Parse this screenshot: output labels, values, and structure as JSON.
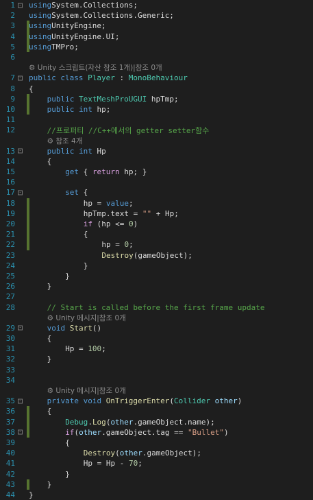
{
  "editor": {
    "language": "C#",
    "lines": [
      {
        "n": "1",
        "indent": 0,
        "changed": false,
        "fold": "-",
        "tokens": [
          [
            "kw",
            "using"
          ],
          [
            "",
            "System.Collections;"
          ]
        ]
      },
      {
        "n": "2",
        "indent": 0,
        "changed": false,
        "fold": "",
        "tokens": [
          [
            "kw",
            "using"
          ],
          [
            "",
            "System.Collections.Generic;"
          ]
        ]
      },
      {
        "n": "3",
        "indent": 0,
        "changed": true,
        "fold": "",
        "tokens": [
          [
            "kw",
            "using"
          ],
          [
            "",
            "UnityEngine;"
          ]
        ]
      },
      {
        "n": "4",
        "indent": 0,
        "changed": true,
        "fold": "",
        "tokens": [
          [
            "kw",
            "using"
          ],
          [
            "",
            "UnityEngine.UI;"
          ]
        ]
      },
      {
        "n": "5",
        "indent": 0,
        "changed": true,
        "fold": "",
        "tokens": [
          [
            "kw",
            "using"
          ],
          [
            "",
            "TMPro;"
          ]
        ]
      },
      {
        "n": "6",
        "indent": 0,
        "changed": false,
        "fold": "",
        "tokens": []
      },
      {
        "lens": "Unity 스크립트(자산 참조 1개)|참조 0개",
        "indent": 0
      },
      {
        "n": "7",
        "indent": 0,
        "changed": false,
        "fold": "-",
        "tokens": [
          [
            "kw",
            "public class "
          ],
          [
            "cls",
            "Player"
          ],
          [
            "",
            " : "
          ],
          [
            "cls",
            "MonoBehaviour"
          ]
        ]
      },
      {
        "n": "8",
        "indent": 0,
        "changed": false,
        "fold": "",
        "tokens": [
          [
            "",
            "{"
          ]
        ]
      },
      {
        "n": "9",
        "indent": 2,
        "changed": true,
        "fold": "",
        "tokens": [
          [
            "kw",
            "public "
          ],
          [
            "cls",
            "TextMeshProUGUI"
          ],
          [
            "",
            " hpTmp;"
          ]
        ]
      },
      {
        "n": "10",
        "indent": 2,
        "changed": true,
        "fold": "",
        "tokens": [
          [
            "kw",
            "public int "
          ],
          [
            "",
            "hp;"
          ]
        ]
      },
      {
        "n": "11",
        "indent": 0,
        "changed": false,
        "fold": "",
        "tokens": []
      },
      {
        "n": "12",
        "indent": 2,
        "changed": false,
        "fold": "",
        "tokens": [
          [
            "cmt",
            "//프로퍼티 //C++에서의 getter setter함수"
          ]
        ]
      },
      {
        "lens": "참조 4개",
        "indent": 2
      },
      {
        "n": "13",
        "indent": 2,
        "changed": false,
        "fold": "-",
        "tokens": [
          [
            "kw",
            "public int "
          ],
          [
            "",
            "Hp"
          ]
        ]
      },
      {
        "n": "14",
        "indent": 2,
        "changed": false,
        "fold": "",
        "tokens": [
          [
            "",
            "{"
          ]
        ]
      },
      {
        "n": "15",
        "indent": 4,
        "changed": false,
        "fold": "",
        "tokens": [
          [
            "kw",
            "get"
          ],
          [
            "",
            " { "
          ],
          [
            "ctl",
            "return"
          ],
          [
            "",
            " hp; }"
          ]
        ]
      },
      {
        "n": "16",
        "indent": 0,
        "changed": false,
        "fold": "",
        "tokens": []
      },
      {
        "n": "17",
        "indent": 4,
        "changed": false,
        "fold": "-",
        "tokens": [
          [
            "kw",
            "set"
          ],
          [
            "",
            " {"
          ]
        ]
      },
      {
        "n": "18",
        "indent": 6,
        "changed": true,
        "fold": "",
        "tokens": [
          [
            "",
            "hp = "
          ],
          [
            "kw",
            "value"
          ],
          [
            ";"
          ]
        ]
      },
      {
        "n": "19",
        "indent": 6,
        "changed": true,
        "fold": "",
        "tokens": [
          [
            "",
            "hpTmp.text = "
          ],
          [
            "str",
            "\"\""
          ],
          [
            "",
            " + Hp;"
          ]
        ]
      },
      {
        "n": "20",
        "indent": 6,
        "changed": true,
        "fold": "",
        "tokens": [
          [
            "ctl",
            "if"
          ],
          [
            "",
            " (hp <= "
          ],
          [
            "num",
            "0"
          ],
          [
            ")"
          ]
        ]
      },
      {
        "n": "21",
        "indent": 6,
        "changed": true,
        "fold": "",
        "tokens": [
          [
            "",
            "{"
          ]
        ]
      },
      {
        "n": "22",
        "indent": 8,
        "changed": true,
        "fold": "",
        "tokens": [
          [
            "",
            "hp = "
          ],
          [
            "num",
            "0"
          ],
          [
            ";"
          ]
        ]
      },
      {
        "n": "23",
        "indent": 8,
        "changed": false,
        "fold": "",
        "tokens": [
          [
            "fn",
            "Destroy"
          ],
          [
            "",
            "(gameObject);"
          ]
        ]
      },
      {
        "n": "24",
        "indent": 6,
        "changed": false,
        "fold": "",
        "tokens": [
          [
            "",
            "}"
          ]
        ]
      },
      {
        "n": "25",
        "indent": 4,
        "changed": false,
        "fold": "",
        "tokens": [
          [
            "",
            "}"
          ]
        ]
      },
      {
        "n": "26",
        "indent": 2,
        "changed": false,
        "fold": "",
        "tokens": [
          [
            "",
            "}"
          ]
        ]
      },
      {
        "n": "27",
        "indent": 0,
        "changed": false,
        "fold": "",
        "tokens": []
      },
      {
        "n": "28",
        "indent": 2,
        "changed": false,
        "fold": "",
        "tokens": [
          [
            "cmt",
            "// Start is called before the first frame update"
          ]
        ]
      },
      {
        "lens": "Unity 메시지|참조 0개",
        "indent": 2
      },
      {
        "n": "29",
        "indent": 2,
        "changed": false,
        "fold": "-",
        "tokens": [
          [
            "kw",
            "void "
          ],
          [
            "fn",
            "Start"
          ],
          [
            "",
            "()"
          ]
        ]
      },
      {
        "n": "30",
        "indent": 2,
        "changed": false,
        "fold": "",
        "tokens": [
          [
            "",
            "{"
          ]
        ]
      },
      {
        "n": "31",
        "indent": 4,
        "changed": false,
        "fold": "",
        "tokens": [
          [
            "",
            "Hp = "
          ],
          [
            "num",
            "100"
          ],
          [
            ";"
          ]
        ]
      },
      {
        "n": "32",
        "indent": 2,
        "changed": false,
        "fold": "",
        "tokens": [
          [
            "",
            "}"
          ]
        ]
      },
      {
        "n": "33",
        "indent": 0,
        "changed": false,
        "fold": "",
        "tokens": []
      },
      {
        "n": "34",
        "indent": 0,
        "changed": false,
        "fold": "",
        "tokens": []
      },
      {
        "lens": "Unity 메시지|참조 0개",
        "indent": 2
      },
      {
        "n": "35",
        "indent": 2,
        "changed": false,
        "fold": "-",
        "tokens": [
          [
            "kw",
            "private void "
          ],
          [
            "fn",
            "OnTriggerEnter"
          ],
          [
            "",
            "("
          ],
          [
            "cls",
            "Collider"
          ],
          [
            "",
            " "
          ],
          [
            "var",
            "other"
          ],
          [
            ")"
          ]
        ]
      },
      {
        "n": "36",
        "indent": 2,
        "changed": true,
        "fold": "",
        "tokens": [
          [
            "",
            "{"
          ]
        ]
      },
      {
        "n": "37",
        "indent": 4,
        "changed": true,
        "fold": "",
        "tokens": [
          [
            "cls",
            "Debug"
          ],
          [
            "",
            "."
          ],
          [
            "fn",
            "Log"
          ],
          [
            "",
            "("
          ],
          [
            "var",
            "other"
          ],
          [
            "",
            ".gameObject.name);"
          ]
        ]
      },
      {
        "n": "38",
        "indent": 4,
        "changed": true,
        "fold": "-",
        "tokens": [
          [
            "ctl",
            "if"
          ],
          [
            "",
            "("
          ],
          [
            "var",
            "other"
          ],
          [
            "",
            ".gameObject.tag == "
          ],
          [
            "str",
            "\"Bullet\""
          ],
          [
            ")"
          ]
        ]
      },
      {
        "n": "39",
        "indent": 4,
        "changed": false,
        "fold": "",
        "tokens": [
          [
            "",
            "{"
          ]
        ]
      },
      {
        "n": "40",
        "indent": 6,
        "changed": false,
        "fold": "",
        "tokens": [
          [
            "fn",
            "Destroy"
          ],
          [
            "",
            "("
          ],
          [
            "var",
            "other"
          ],
          [
            "",
            ".gameObject);"
          ]
        ]
      },
      {
        "n": "41",
        "indent": 6,
        "changed": false,
        "fold": "",
        "tokens": [
          [
            "",
            "Hp = Hp - "
          ],
          [
            "num",
            "70"
          ],
          [
            ";"
          ]
        ]
      },
      {
        "n": "42",
        "indent": 4,
        "changed": false,
        "fold": "",
        "tokens": [
          [
            "",
            "}"
          ]
        ]
      },
      {
        "n": "43",
        "indent": 2,
        "changed": true,
        "fold": "",
        "tokens": [
          [
            "",
            "}"
          ]
        ]
      },
      {
        "n": "44",
        "indent": 0,
        "changed": false,
        "fold": "",
        "tokens": [
          [
            "",
            "}"
          ]
        ]
      }
    ],
    "colors": {
      "background": "#1e1e1e",
      "line_number": "#2b91af",
      "keyword": "#569cd6",
      "type": "#4ec9b0",
      "string": "#d69d85",
      "number": "#b5cea8",
      "comment": "#57a64a",
      "method": "#dcdcaa",
      "parameter": "#9cdcfe",
      "control": "#d8a0df",
      "change_bar": "#577430",
      "codelens": "#8e8e8e"
    },
    "icons": {
      "fold_toggle": "minus-box-icon",
      "codelens": "unity-icon"
    }
  }
}
